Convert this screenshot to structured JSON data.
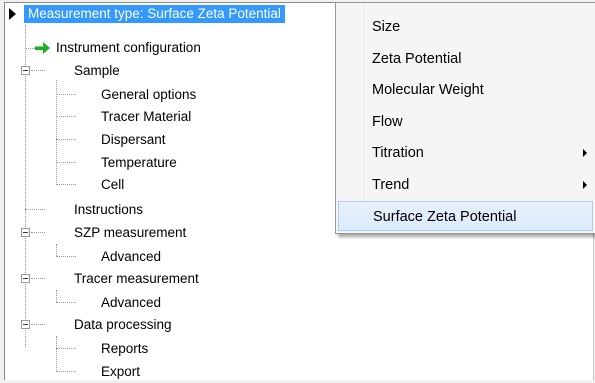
{
  "tree": {
    "root_label": "Measurement type: Surface Zeta Potential",
    "items": [
      {
        "label": "Instrument configuration"
      },
      {
        "label": "Sample"
      },
      {
        "label": "General options"
      },
      {
        "label": "Tracer Material"
      },
      {
        "label": "Dispersant"
      },
      {
        "label": "Temperature"
      },
      {
        "label": "Cell"
      },
      {
        "label": "Instructions"
      },
      {
        "label": "SZP measurement"
      },
      {
        "label": "Advanced"
      },
      {
        "label": "Tracer measurement"
      },
      {
        "label": "Advanced"
      },
      {
        "label": "Data processing"
      },
      {
        "label": "Reports"
      },
      {
        "label": "Export"
      }
    ]
  },
  "context_menu": {
    "items": [
      {
        "label": "Size"
      },
      {
        "label": "Zeta Potential"
      },
      {
        "label": "Molecular Weight"
      },
      {
        "label": "Flow"
      },
      {
        "label": "Titration"
      },
      {
        "label": "Trend"
      },
      {
        "label": "Surface Zeta Potential"
      }
    ],
    "selected": "Surface Zeta Potential"
  },
  "colors": {
    "selection": "#3399ff",
    "menu_highlight": "#dcebfc"
  }
}
